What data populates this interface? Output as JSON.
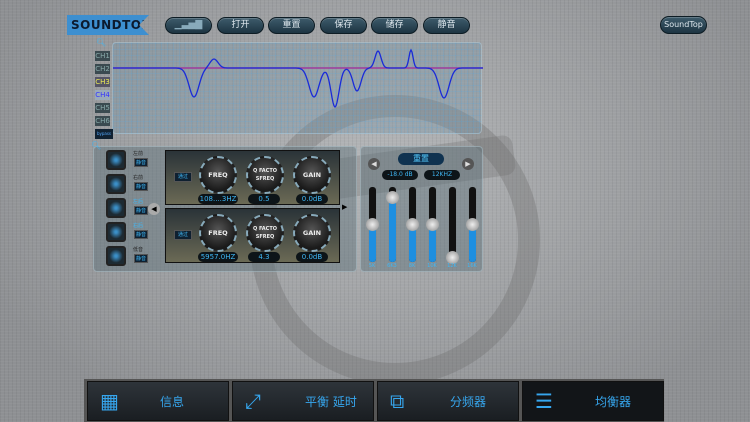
{
  "logo": "SOUNDTOP",
  "toolbar": {
    "signal": "signal-bars",
    "buttons": [
      "打开",
      "重置",
      "保存",
      "储存",
      "静音"
    ],
    "brand": "SoundTop"
  },
  "graph": {
    "channels": [
      "CH1",
      "CH2",
      "CH3",
      "CH4",
      "CH5",
      "CH6"
    ],
    "bypass": "bypass"
  },
  "eq": {
    "channels": [
      {
        "label": "左前",
        "btn": "静音"
      },
      {
        "label": "右前",
        "btn": "静音"
      },
      {
        "label": "左后",
        "btn": "静音"
      },
      {
        "label": "右后",
        "btn": "静音"
      },
      {
        "label": "低音",
        "btn": "静音"
      }
    ],
    "filters": [
      {
        "type": "通过",
        "freq_label": "FREQ",
        "q_label": "Q FACTO\nSFREQ",
        "gain_label": "GAIN",
        "freq": "108....3HZ",
        "q": "0.5",
        "gain": "0.0dB"
      },
      {
        "type": "通过",
        "freq_label": "FREQ",
        "q_label": "Q FACTO\nSFREQ",
        "gain_label": "GAIN",
        "freq": "5957.0HZ",
        "q": "4.3",
        "gain": "0.0dB"
      }
    ]
  },
  "bands": {
    "title": "重置",
    "gain": "-18.0 dB",
    "freq": "12KHZ",
    "sliders": [
      {
        "label": "5K",
        "level": 0.5
      },
      {
        "label": "6K3",
        "level": 0.85
      },
      {
        "label": "8K",
        "level": 0.5
      },
      {
        "label": "10K",
        "level": 0.5
      },
      {
        "label": "12K",
        "level": 0.05
      },
      {
        "label": "16K",
        "level": 0.5
      }
    ]
  },
  "nav": [
    {
      "label": "信息",
      "icon": "grid-icon"
    },
    {
      "label": "平衡 延时",
      "icon": "expand-icon"
    },
    {
      "label": "分频器",
      "icon": "crossover-icon"
    },
    {
      "label": "均衡器",
      "icon": "list-icon"
    }
  ]
}
